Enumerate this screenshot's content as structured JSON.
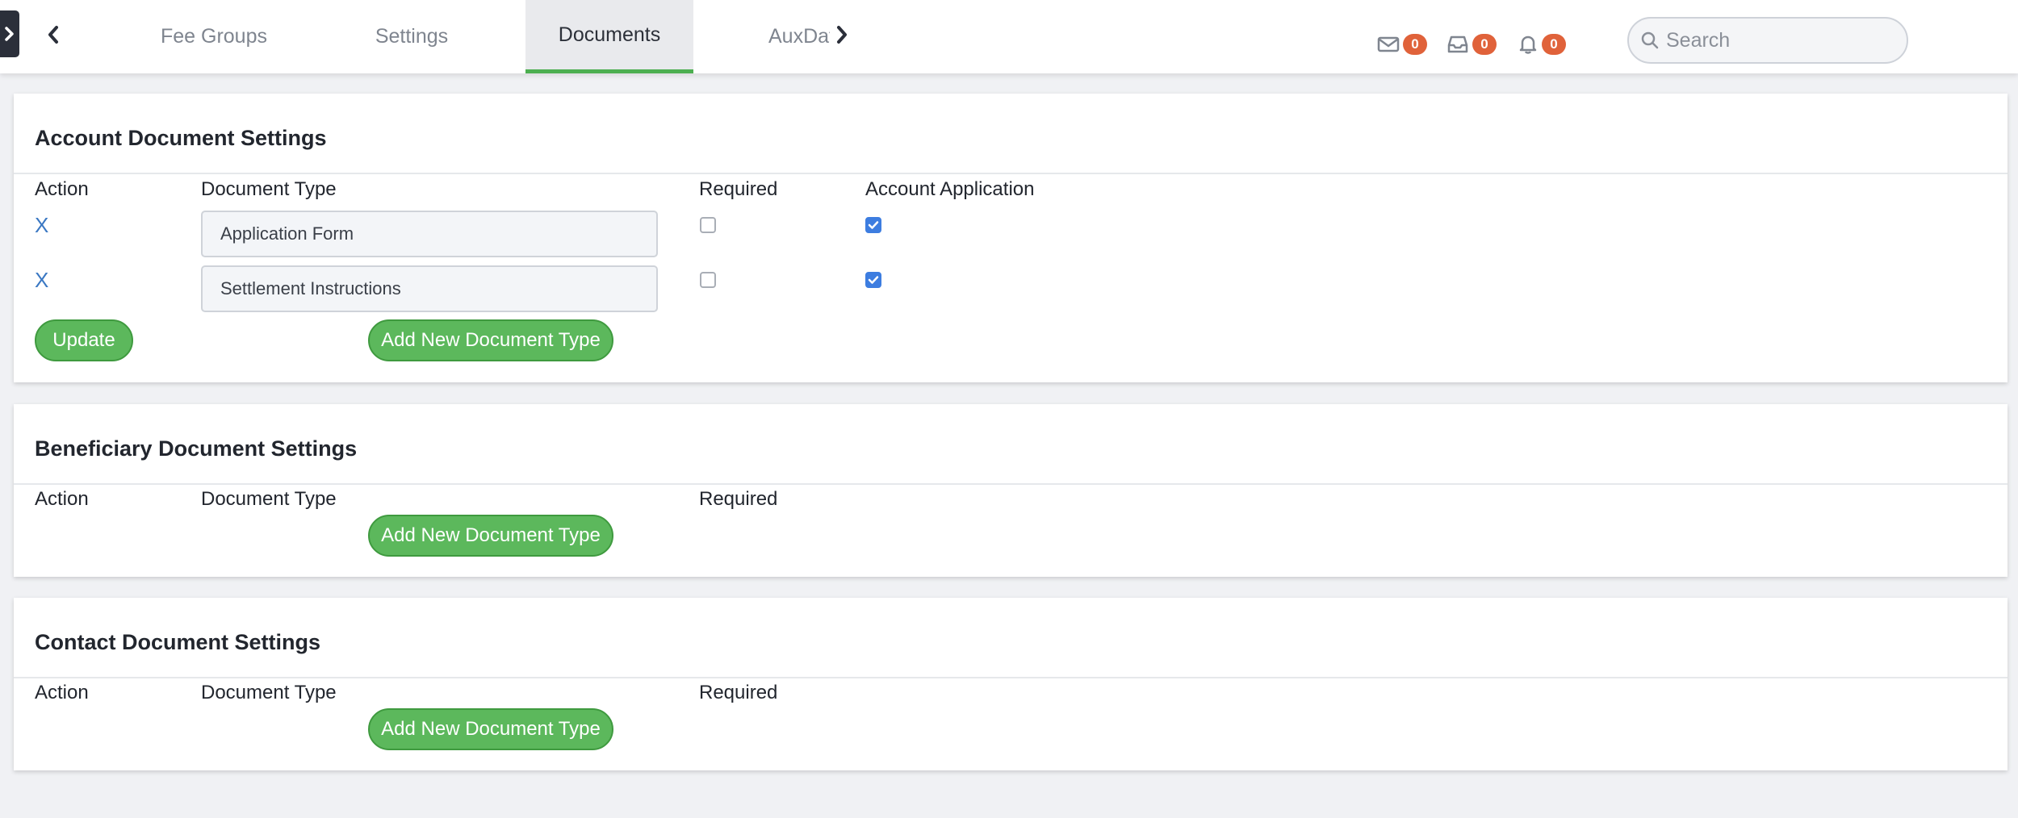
{
  "topbar": {
    "tabs": [
      {
        "label": "Fee Groups"
      },
      {
        "label": "Settings"
      },
      {
        "label": "Documents"
      },
      {
        "label": "AuxData"
      }
    ],
    "notifications": {
      "messages_count": "0",
      "inbox_count": "0",
      "alerts_count": "0"
    },
    "search": {
      "placeholder": "Search",
      "value": ""
    }
  },
  "account_section": {
    "title": "Account Document Settings",
    "col_action": "Action",
    "col_document_type": "Document Type",
    "col_required": "Required",
    "col_account_application": "Account Application",
    "rows": [
      {
        "remove_label": "X",
        "document_type": "Application Form",
        "required": false,
        "account_application": true
      },
      {
        "remove_label": "X",
        "document_type": "Settlement Instructions",
        "required": false,
        "account_application": true
      }
    ],
    "update_label": "Update",
    "add_label": "Add New Document Type"
  },
  "beneficiary_section": {
    "title": "Beneficiary Document Settings",
    "col_action": "Action",
    "col_document_type": "Document Type",
    "col_required": "Required",
    "add_label": "Add New Document Type"
  },
  "contact_section": {
    "title": "Contact Document Settings",
    "col_action": "Action",
    "col_document_type": "Document Type",
    "col_required": "Required",
    "add_label": "Add New Document Type"
  },
  "colors": {
    "accent_green": "#5cb85c",
    "badge_orange": "#e0623a",
    "link_blue": "#3b78c3",
    "checkbox_blue": "#3d7de0"
  }
}
